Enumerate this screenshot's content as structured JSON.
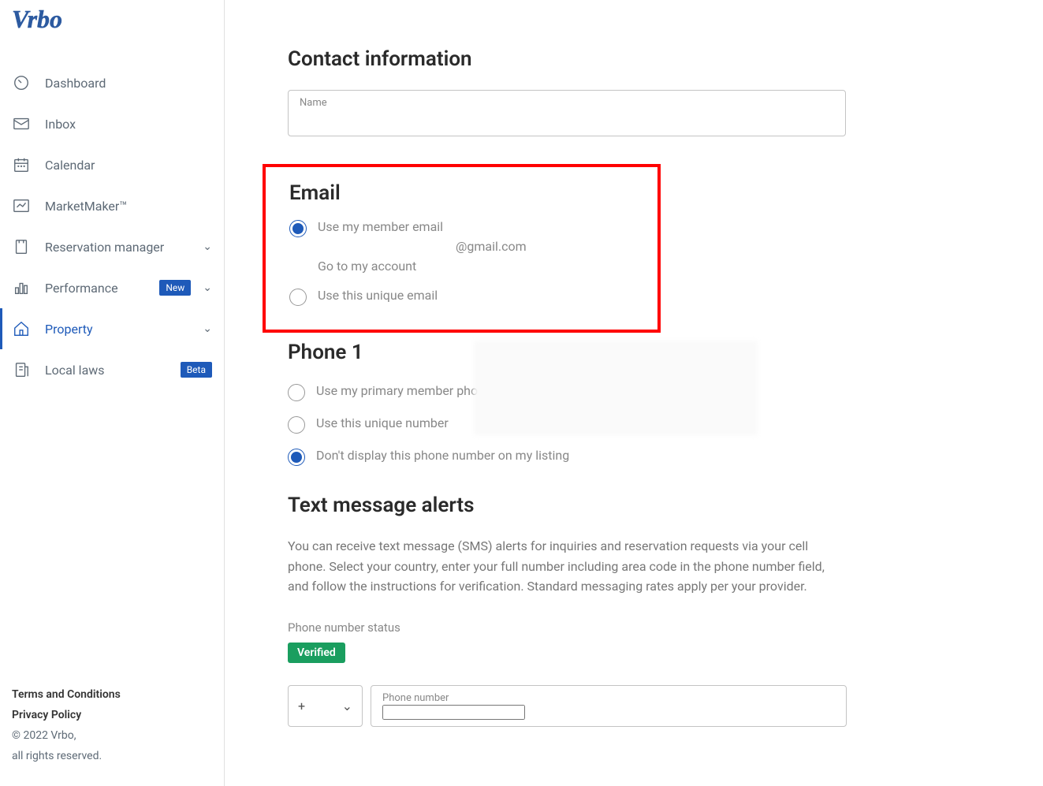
{
  "brand": "Vrbo",
  "sidebar": {
    "items": [
      {
        "label": "Dashboard",
        "icon": "dashboard"
      },
      {
        "label": "Inbox",
        "icon": "inbox"
      },
      {
        "label": "Calendar",
        "icon": "calendar"
      },
      {
        "label": "MarketMaker™",
        "icon": "market"
      },
      {
        "label": "Reservation manager",
        "icon": "reservation",
        "expandable": true
      },
      {
        "label": "Performance",
        "icon": "performance",
        "badge": "New",
        "expandable": true
      },
      {
        "label": "Property",
        "icon": "property",
        "expandable": true,
        "active": true
      },
      {
        "label": "Local laws",
        "icon": "laws",
        "badge": "Beta"
      }
    ],
    "footer": {
      "terms": "Terms and Conditions",
      "privacy": "Privacy Policy",
      "copyright": "© 2022 Vrbo,",
      "rights": "all rights reserved."
    }
  },
  "contact": {
    "heading": "Contact information",
    "name_label": "Name"
  },
  "email": {
    "heading": "Email",
    "option1": "Use my member email",
    "email_suffix": "@gmail.com",
    "account_link": "Go to my account",
    "option2": "Use this unique email"
  },
  "phone": {
    "heading": "Phone 1",
    "option1": "Use my primary member phon",
    "option2": "Use this unique number",
    "option3": "Don't display this phone number on my listing"
  },
  "text_alerts": {
    "heading": "Text message alerts",
    "description": "You can receive text message (SMS) alerts for inquiries and reservation requests via your cell phone. Select your country, enter your full number including area code in the phone number field, and follow the instructions for verification. Standard messaging rates apply per your provider.",
    "status_label": "Phone number status",
    "status_badge": "Verified",
    "country_prefix": "+",
    "phone_label": "Phone number"
  }
}
